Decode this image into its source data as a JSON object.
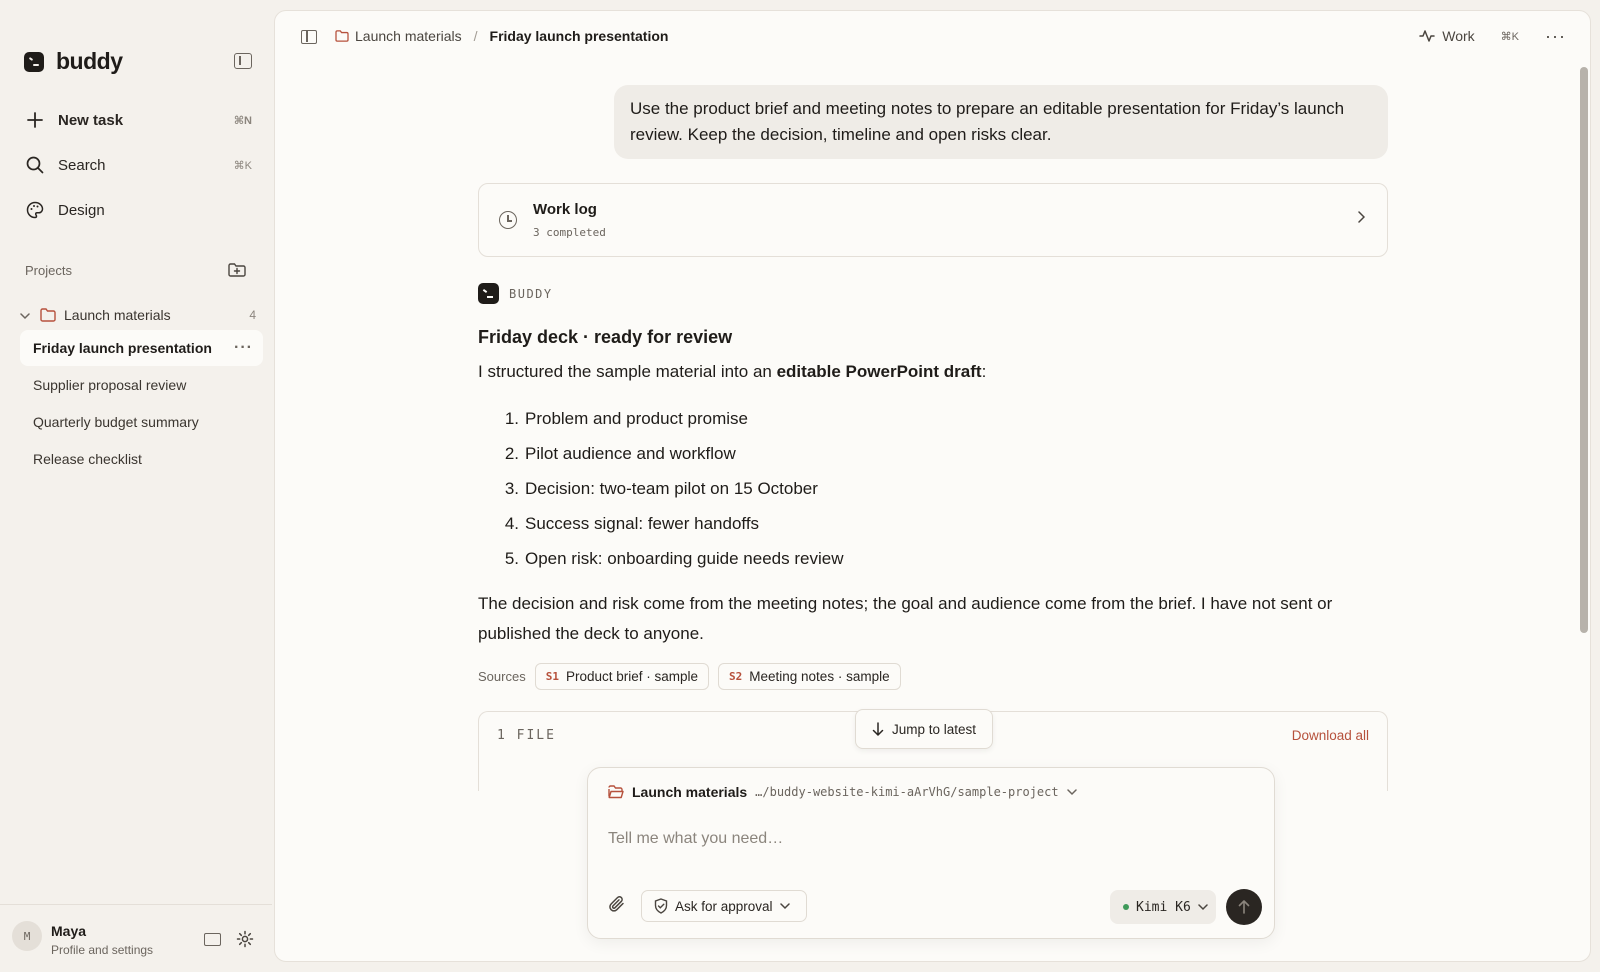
{
  "app": {
    "name": "buddy"
  },
  "sidebar": {
    "nav": [
      {
        "label": "New task",
        "shortcut": "⌘N"
      },
      {
        "label": "Search",
        "shortcut": "⌘K"
      },
      {
        "label": "Design",
        "shortcut": ""
      }
    ],
    "projects_label": "Projects",
    "project": {
      "name": "Launch materials",
      "count": "4"
    },
    "tasks": [
      {
        "label": "Friday launch presentation",
        "active": true
      },
      {
        "label": "Supplier proposal review",
        "active": false
      },
      {
        "label": "Quarterly budget summary",
        "active": false
      },
      {
        "label": "Release checklist",
        "active": false
      }
    ],
    "profile": {
      "initial": "M",
      "name": "Maya",
      "sub": "Profile and settings"
    }
  },
  "topbar": {
    "breadcrumb_project": "Launch materials",
    "breadcrumb_sep": "/",
    "breadcrumb_current": "Friday launch presentation",
    "work_label": "Work",
    "shortcut": "⌘K"
  },
  "conversation": {
    "user_message": "Use the product brief and meeting notes to prepare an editable presentation for Friday’s launch review. Keep the decision, timeline and open risks clear.",
    "worklog": {
      "title": "Work log",
      "sub": "3 completed"
    },
    "agent_name": "BUDDY",
    "reply_title": "Friday deck · ready for review",
    "reply_intro_before": "I structured the sample material into an ",
    "reply_intro_bold": "editable PowerPoint draft",
    "reply_intro_after": ":",
    "reply_list": [
      {
        "num": "1.",
        "text": "Problem and product promise"
      },
      {
        "num": "2.",
        "text": "Pilot audience and workflow"
      },
      {
        "num": "3.",
        "text": "Decision: two-team pilot on 15 October"
      },
      {
        "num": "4.",
        "text": "Success signal: fewer handoffs"
      },
      {
        "num": "5.",
        "text": "Open risk: onboarding guide needs review"
      }
    ],
    "reply_para": "The decision and risk come from the meeting notes; the goal and audience come from the brief. I have not sent or published the deck to anyone.",
    "sources_label": "Sources",
    "sources": [
      {
        "tag": "S1",
        "label": "Product brief · sample"
      },
      {
        "tag": "S2",
        "label": "Meeting notes · sample"
      }
    ],
    "files": {
      "count_label": "1 FILE",
      "download_label": "Download all"
    },
    "jump_label": "Jump to latest"
  },
  "composer": {
    "project_name": "Launch materials",
    "path": "…/buddy-website-kimi-aArVhG/sample-project",
    "placeholder": "Tell me what you need…",
    "approval_label": "Ask for approval",
    "model_label": "Kimi K6"
  },
  "colors": {
    "accent": "#b6513c",
    "background": "#f4f1ec",
    "surface": "#fcfbf8",
    "status_dot": "#3f9a5a"
  }
}
